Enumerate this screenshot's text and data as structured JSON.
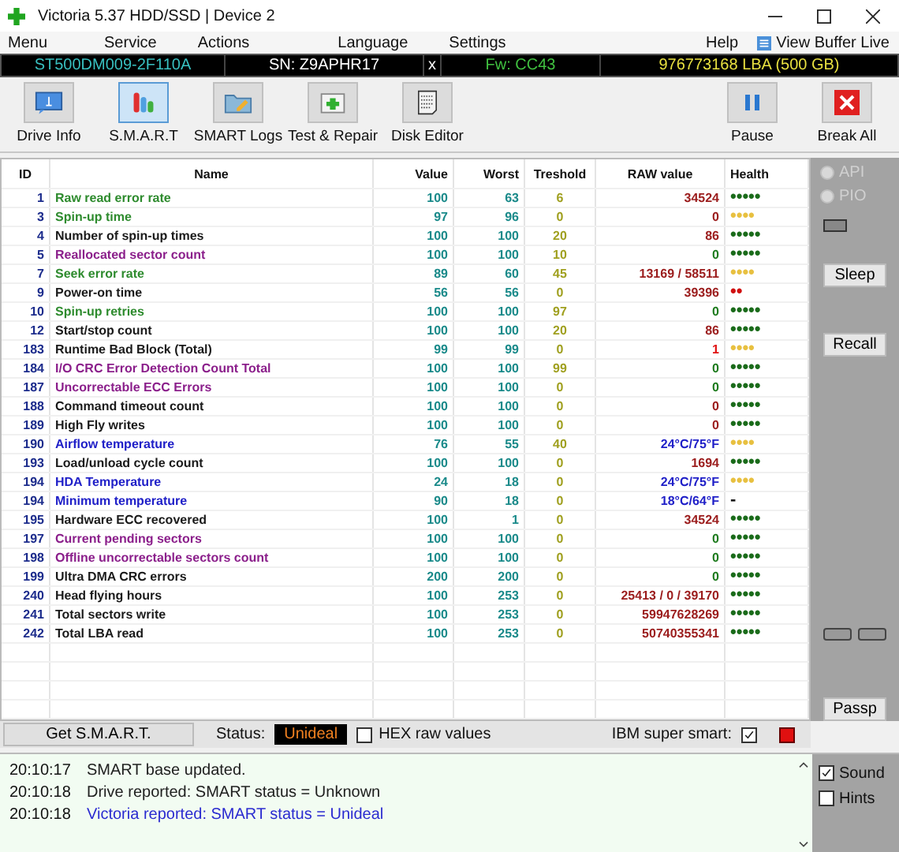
{
  "window": {
    "title": "Victoria 5.37 HDD/SSD | Device 2"
  },
  "menu": [
    "Menu",
    "Service",
    "Actions",
    "Language",
    "Settings",
    "Help"
  ],
  "view_buffer": "View Buffer Live",
  "drive_bar": {
    "model": "ST500DM009-2F110A",
    "serial": "SN: Z9APHR17",
    "close": "x",
    "firmware": "Fw: CC43",
    "capacity": "976773168 LBA (500 GB)"
  },
  "toolbar": [
    {
      "kind": "info",
      "label": "Drive Info",
      "selected": false
    },
    {
      "kind": "smart",
      "label": "S.M.A.R.T",
      "selected": true
    },
    {
      "kind": "logs",
      "label": "SMART Logs",
      "selected": false
    },
    {
      "kind": "repair",
      "label": "Test & Repair",
      "selected": false
    },
    {
      "kind": "editor",
      "label": "Disk Editor",
      "selected": false
    }
  ],
  "toolbar_right": [
    {
      "kind": "pause",
      "label": "Pause"
    },
    {
      "kind": "break",
      "label": "Break All"
    }
  ],
  "table": {
    "columns": [
      "ID",
      "Name",
      "Value",
      "Worst",
      "Treshold",
      "RAW value",
      "Health"
    ],
    "rows": [
      {
        "id": "1",
        "name": {
          "text": "Raw read error rate",
          "color": "#2e8b2e"
        },
        "value": "100",
        "worst": "63",
        "threshold": "6",
        "raw": {
          "text": "34524",
          "color": "#9b1c1c"
        },
        "health": {
          "text": "•••••",
          "color": "#1a6b1a"
        }
      },
      {
        "id": "3",
        "name": {
          "text": "Spin-up time",
          "color": "#2e8b2e"
        },
        "value": "97",
        "worst": "96",
        "threshold": "0",
        "raw": {
          "text": "0",
          "color": "#9b1c1c"
        },
        "health": {
          "text": "••••",
          "color": "#e8c040"
        }
      },
      {
        "id": "4",
        "name": {
          "text": "Number of spin-up times",
          "color": "#1a1a1a"
        },
        "value": "100",
        "worst": "100",
        "threshold": "20",
        "raw": {
          "text": "86",
          "color": "#9b1c1c"
        },
        "health": {
          "text": "•••••",
          "color": "#1a6b1a"
        }
      },
      {
        "id": "5",
        "name": {
          "text": "Reallocated sector count",
          "color": "#8b1f8b"
        },
        "value": "100",
        "worst": "100",
        "threshold": "10",
        "raw": {
          "text": "0",
          "color": "#1e7b1e"
        },
        "health": {
          "text": "•••••",
          "color": "#1a6b1a"
        }
      },
      {
        "id": "7",
        "name": {
          "text": "Seek error rate",
          "color": "#2e8b2e"
        },
        "value": "89",
        "worst": "60",
        "threshold": "45",
        "raw": {
          "text": "13169 / 58511",
          "color": "#9b1c1c"
        },
        "health": {
          "text": "••••",
          "color": "#e8c040"
        }
      },
      {
        "id": "9",
        "name": {
          "text": "Power-on time",
          "color": "#1a1a1a"
        },
        "value": "56",
        "worst": "56",
        "threshold": "0",
        "raw": {
          "text": "39396",
          "color": "#9b1c1c"
        },
        "health": {
          "text": "••",
          "color": "#d01010"
        }
      },
      {
        "id": "10",
        "name": {
          "text": "Spin-up retries",
          "color": "#2e8b2e"
        },
        "value": "100",
        "worst": "100",
        "threshold": "97",
        "raw": {
          "text": "0",
          "color": "#1e7b1e"
        },
        "health": {
          "text": "•••••",
          "color": "#1a6b1a"
        }
      },
      {
        "id": "12",
        "name": {
          "text": "Start/stop count",
          "color": "#1a1a1a"
        },
        "value": "100",
        "worst": "100",
        "threshold": "20",
        "raw": {
          "text": "86",
          "color": "#9b1c1c"
        },
        "health": {
          "text": "•••••",
          "color": "#1a6b1a"
        }
      },
      {
        "id": "183",
        "name": {
          "text": "Runtime Bad Block (Total)",
          "color": "#1a1a1a"
        },
        "value": "99",
        "worst": "99",
        "threshold": "0",
        "raw": {
          "text": "1",
          "color": "#e01010"
        },
        "health": {
          "text": "••••",
          "color": "#e8c040"
        }
      },
      {
        "id": "184",
        "name": {
          "text": "I/O CRC Error Detection Count Total",
          "color": "#8b1f8b"
        },
        "value": "100",
        "worst": "100",
        "threshold": "99",
        "raw": {
          "text": "0",
          "color": "#1e7b1e"
        },
        "health": {
          "text": "•••••",
          "color": "#1a6b1a"
        }
      },
      {
        "id": "187",
        "name": {
          "text": "Uncorrectable ECC Errors",
          "color": "#8b1f8b"
        },
        "value": "100",
        "worst": "100",
        "threshold": "0",
        "raw": {
          "text": "0",
          "color": "#1e7b1e"
        },
        "health": {
          "text": "•••••",
          "color": "#1a6b1a"
        }
      },
      {
        "id": "188",
        "name": {
          "text": "Command timeout count",
          "color": "#1a1a1a"
        },
        "value": "100",
        "worst": "100",
        "threshold": "0",
        "raw": {
          "text": "0",
          "color": "#9b1c1c"
        },
        "health": {
          "text": "•••••",
          "color": "#1a6b1a"
        }
      },
      {
        "id": "189",
        "name": {
          "text": "High Fly writes",
          "color": "#1a1a1a"
        },
        "value": "100",
        "worst": "100",
        "threshold": "0",
        "raw": {
          "text": "0",
          "color": "#9b1c1c"
        },
        "health": {
          "text": "•••••",
          "color": "#1a6b1a"
        }
      },
      {
        "id": "190",
        "name": {
          "text": "Airflow temperature",
          "color": "#2020c8"
        },
        "value": "76",
        "worst": "55",
        "threshold": "40",
        "raw": {
          "text": "24°C/75°F",
          "color": "#2020c8"
        },
        "health": {
          "text": "••••",
          "color": "#e8c040"
        }
      },
      {
        "id": "193",
        "name": {
          "text": "Load/unload cycle count",
          "color": "#1a1a1a"
        },
        "value": "100",
        "worst": "100",
        "threshold": "0",
        "raw": {
          "text": "1694",
          "color": "#9b1c1c"
        },
        "health": {
          "text": "•••••",
          "color": "#1a6b1a"
        }
      },
      {
        "id": "194",
        "name": {
          "text": "HDA Temperature",
          "color": "#2020c8"
        },
        "value": "24",
        "worst": "18",
        "threshold": "0",
        "raw": {
          "text": "24°C/75°F",
          "color": "#2020c8"
        },
        "health": {
          "text": "••••",
          "color": "#e8c040"
        }
      },
      {
        "id": "194",
        "name": {
          "text": "Minimum temperature",
          "color": "#2020c8"
        },
        "value": "90",
        "worst": "18",
        "threshold": "0",
        "raw": {
          "text": "18°C/64°F",
          "color": "#2020c8"
        },
        "health": {
          "text": "-",
          "color": "#1a1a1a"
        }
      },
      {
        "id": "195",
        "name": {
          "text": "Hardware ECC recovered",
          "color": "#1a1a1a"
        },
        "value": "100",
        "worst": "1",
        "threshold": "0",
        "raw": {
          "text": "34524",
          "color": "#9b1c1c"
        },
        "health": {
          "text": "•••••",
          "color": "#1a6b1a"
        }
      },
      {
        "id": "197",
        "name": {
          "text": "Current pending sectors",
          "color": "#8b1f8b"
        },
        "value": "100",
        "worst": "100",
        "threshold": "0",
        "raw": {
          "text": "0",
          "color": "#1e7b1e"
        },
        "health": {
          "text": "•••••",
          "color": "#1a6b1a"
        }
      },
      {
        "id": "198",
        "name": {
          "text": "Offline uncorrectable sectors count",
          "color": "#8b1f8b"
        },
        "value": "100",
        "worst": "100",
        "threshold": "0",
        "raw": {
          "text": "0",
          "color": "#1e7b1e"
        },
        "health": {
          "text": "•••••",
          "color": "#1a6b1a"
        }
      },
      {
        "id": "199",
        "name": {
          "text": "Ultra DMA CRC errors",
          "color": "#1a1a1a"
        },
        "value": "200",
        "worst": "200",
        "threshold": "0",
        "raw": {
          "text": "0",
          "color": "#1e7b1e"
        },
        "health": {
          "text": "•••••",
          "color": "#1a6b1a"
        }
      },
      {
        "id": "240",
        "name": {
          "text": "Head flying hours",
          "color": "#1a1a1a"
        },
        "value": "100",
        "worst": "253",
        "threshold": "0",
        "raw": {
          "text": "25413 / 0 / 39170",
          "color": "#9b1c1c"
        },
        "health": {
          "text": "•••••",
          "color": "#1a6b1a"
        }
      },
      {
        "id": "241",
        "name": {
          "text": "Total sectors write",
          "color": "#1a1a1a"
        },
        "value": "100",
        "worst": "253",
        "threshold": "0",
        "raw": {
          "text": "59947628269",
          "color": "#9b1c1c"
        },
        "health": {
          "text": "•••••",
          "color": "#1a6b1a"
        }
      },
      {
        "id": "242",
        "name": {
          "text": "Total LBA read",
          "color": "#1a1a1a"
        },
        "value": "100",
        "worst": "253",
        "threshold": "0",
        "raw": {
          "text": "50740355341",
          "color": "#9b1c1c"
        },
        "health": {
          "text": "•••••",
          "color": "#1a6b1a"
        }
      }
    ]
  },
  "side": {
    "radios": [
      {
        "label": "API",
        "selected": false,
        "disabled": true
      },
      {
        "label": "PIO",
        "selected": false,
        "disabled": true
      }
    ],
    "buttons": [
      "Sleep",
      "Recall"
    ],
    "bottom_button": "Passp"
  },
  "status_row": {
    "get_button": "Get S.M.A.R.T.",
    "status_label": "Status:",
    "status": "Unideal",
    "hex": {
      "label": "HEX raw values",
      "checked": false
    },
    "ibm": {
      "label": "IBM super smart:",
      "checked": true
    }
  },
  "log": [
    {
      "time": "20:10:17",
      "text": "SMART base updated.",
      "color": "#202020"
    },
    {
      "time": "20:10:18",
      "text": "Drive reported: SMART status = Unknown",
      "color": "#202020"
    },
    {
      "time": "20:10:18",
      "text": "Victoria reported: SMART status = Unideal",
      "color": "#2a2ad0"
    }
  ],
  "options": [
    {
      "label": "Sound",
      "checked": true
    },
    {
      "label": "Hints",
      "checked": false
    }
  ]
}
